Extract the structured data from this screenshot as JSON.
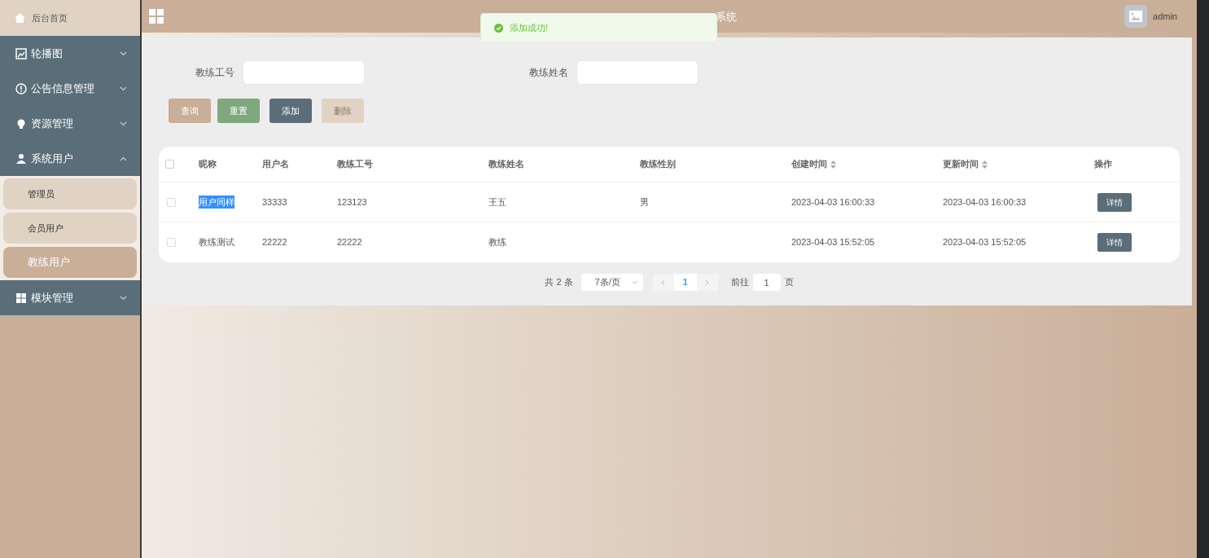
{
  "sidebar": {
    "home": "后台首页",
    "menus": [
      {
        "label": "轮播图",
        "expanded": false
      },
      {
        "label": "公告信息管理",
        "expanded": false
      },
      {
        "label": "资源管理",
        "expanded": false
      },
      {
        "label": "系统用户",
        "expanded": true,
        "children": [
          {
            "label": "管理员",
            "selected": false
          },
          {
            "label": "会员用户",
            "selected": false
          },
          {
            "label": "教练用户",
            "selected": true
          }
        ]
      },
      {
        "label": "模块管理",
        "expanded": false
      }
    ]
  },
  "header": {
    "title": "系统",
    "user": "admin"
  },
  "toast": {
    "message": "添加成功!"
  },
  "search": {
    "fields": [
      {
        "label": "教练工号"
      },
      {
        "label": "教练姓名"
      }
    ],
    "buttons": [
      {
        "label": "查询",
        "kind": "query",
        "disabled": false
      },
      {
        "label": "重置",
        "kind": "reset",
        "disabled": false
      },
      {
        "label": "添加",
        "kind": "add",
        "disabled": false
      },
      {
        "label": "删除",
        "kind": "delete",
        "disabled": true
      }
    ]
  },
  "table": {
    "all_checked": false,
    "columns": [
      {
        "label": "昵称",
        "sortable": false
      },
      {
        "label": "用户名",
        "sortable": false
      },
      {
        "label": "教练工号",
        "sortable": false
      },
      {
        "label": "教练姓名",
        "sortable": false
      },
      {
        "label": "教练性别",
        "sortable": false
      },
      {
        "label": "创建时间",
        "sortable": true
      },
      {
        "label": "更新时间",
        "sortable": true
      },
      {
        "label": "操作",
        "sortable": false
      }
    ],
    "rows": [
      {
        "checked": false,
        "highlighted": true,
        "cells": [
          "用户同样",
          "33333",
          "123123",
          "王五",
          "男",
          "2023-04-03 16:00:33",
          "2023-04-03 16:00:33"
        ],
        "action": "详情"
      },
      {
        "checked": false,
        "highlighted": false,
        "cells": [
          "教练测试",
          "22222",
          "22222",
          "教练",
          "",
          "2023-04-03 15:52:05",
          "2023-04-03 15:52:05"
        ],
        "action": "详情"
      }
    ]
  },
  "pagination": {
    "total": "共 2 条",
    "page_size": "7条/页",
    "pages": [
      {
        "label": "1",
        "selected": true
      }
    ],
    "goto_label": "前往",
    "goto_value": "1",
    "goto_suffix": "页"
  }
}
